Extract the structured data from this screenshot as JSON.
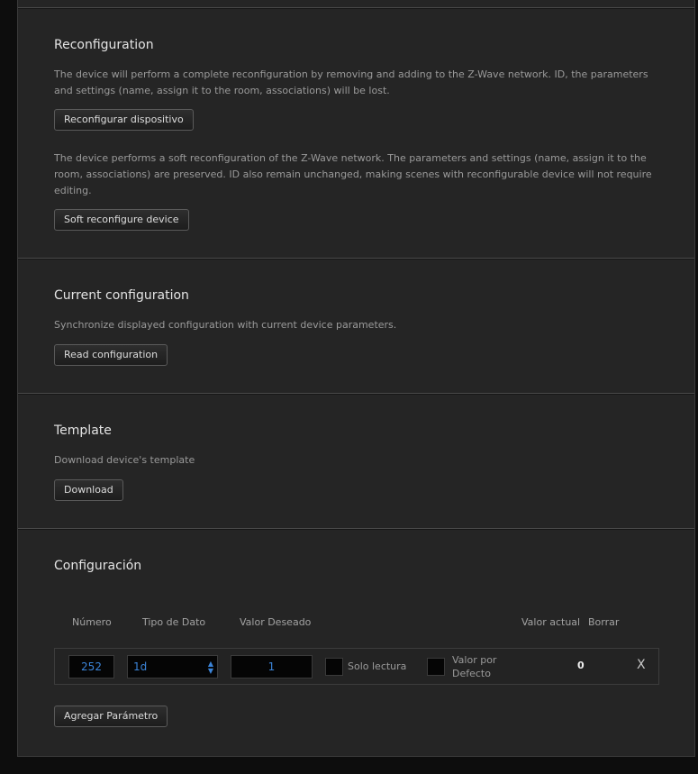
{
  "reconfiguration": {
    "title": "Reconfiguration",
    "hard_description": "The device will perform a complete reconfiguration by removing and adding to the Z-Wave network. ID, the parameters and settings (name, assign it to the room, associations) will be lost.",
    "hard_button": "Reconfigurar dispositivo",
    "soft_description": "The device performs a soft reconfiguration of the Z-Wave network. The parameters and settings (name, assign it to the room, associations) are preserved. ID also remain unchanged, making scenes with reconfigurable device will not require editing.",
    "soft_button": "Soft reconfigure device"
  },
  "current_configuration": {
    "title": "Current configuration",
    "description": "Synchronize displayed configuration with current device parameters.",
    "button": "Read configuration"
  },
  "template": {
    "title": "Template",
    "description": "Download device's template",
    "button": "Download"
  },
  "configuracion": {
    "title": "Configuración",
    "columns": {
      "numero": "Número",
      "tipo": "Tipo de Dato",
      "valor_deseado": "Valor Deseado",
      "valor_actual": "Valor actual",
      "borrar": "Borrar"
    },
    "row": {
      "numero": "252",
      "tipo": "1d",
      "valor_deseado": "1",
      "solo_lectura_label": "Solo lectura",
      "solo_lectura_checked": false,
      "valor_defecto_label": "Valor por Defecto",
      "valor_defecto_checked": false,
      "valor_actual": "0",
      "delete_label": "X"
    },
    "add_button": "Agregar Parámetro"
  },
  "colors": {
    "background": "#252525",
    "outer": "#0d0d0d",
    "text": "#e4e4e4",
    "muted_text": "#9a9a9a",
    "input_value": "#3b84d8"
  }
}
